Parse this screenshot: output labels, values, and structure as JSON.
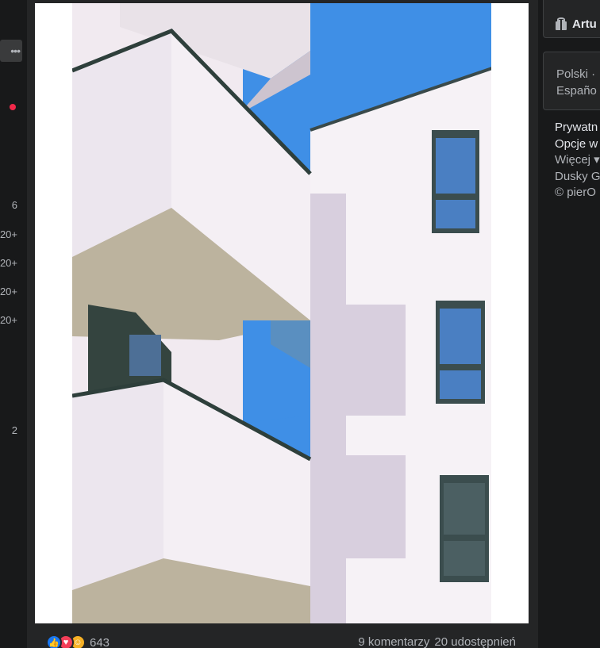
{
  "left_sidebar": {
    "more_label": "•••",
    "badges": [
      "6",
      "20+",
      "20+",
      "20+",
      "20+",
      "2"
    ]
  },
  "post": {
    "reactions": {
      "icons": [
        "like-icon",
        "love-icon",
        "care-icon"
      ],
      "count": "643"
    },
    "comments_label": "9 komentarzy",
    "shares_label": "20 udostępnień"
  },
  "right_column": {
    "top_card_label": "Artu",
    "languages": [
      "Polski ·",
      "Españo"
    ],
    "links": [
      "Prywatn",
      "Opcje w",
      "Więcej ▾",
      "Dusky G",
      "© pierO"
    ]
  },
  "colors": {
    "page_bg": "#18191a",
    "card_bg": "#242526",
    "sky": "#3f8fe6",
    "like": "#1877f2",
    "love": "#f33e58",
    "notification": "#f02849"
  }
}
